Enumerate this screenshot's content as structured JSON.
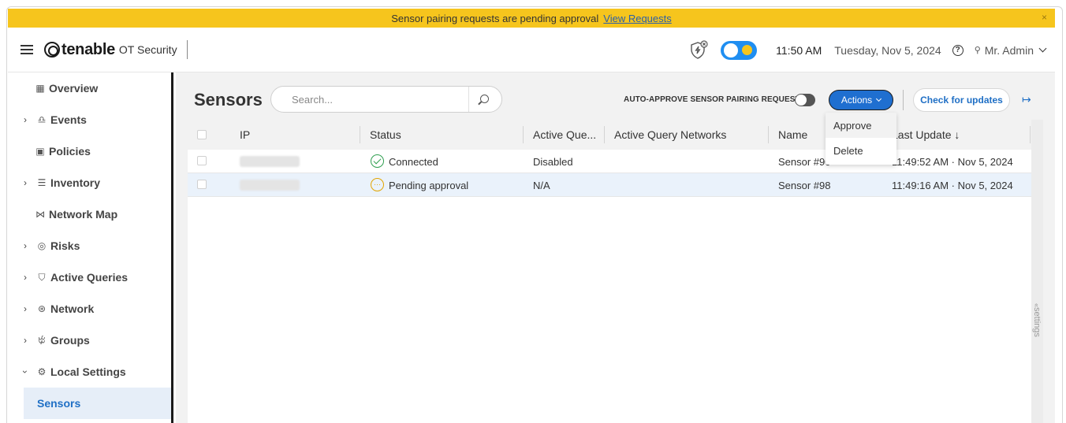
{
  "banner": {
    "message": "Sensor pairing requests are pending approval",
    "link": "View Requests",
    "close": "×"
  },
  "header": {
    "brand": "tenable",
    "product": "OT Security",
    "time": "11:50 AM",
    "date": "Tuesday, Nov 5, 2024",
    "help": "?",
    "user": "Mr. Admin",
    "theme_toggle": "dark-mode-toggle"
  },
  "sidebar": {
    "items": [
      {
        "label": "Overview",
        "icon": "grid-icon"
      },
      {
        "label": "Events",
        "icon": "bell-icon"
      },
      {
        "label": "Policies",
        "icon": "policies-icon"
      },
      {
        "label": "Inventory",
        "icon": "list-icon"
      },
      {
        "label": "Network Map",
        "icon": "network-map-icon"
      },
      {
        "label": "Risks",
        "icon": "risk-icon"
      },
      {
        "label": "Active Queries",
        "icon": "shield-icon"
      },
      {
        "label": "Network",
        "icon": "network-icon"
      },
      {
        "label": "Groups",
        "icon": "groups-icon"
      },
      {
        "label": "Local Settings",
        "icon": "settings-gear-icon"
      },
      {
        "label": "Sensors"
      }
    ]
  },
  "main": {
    "title": "Sensors",
    "search_placeholder": "Search...",
    "auto_approve_label": "AUTO-APPROVE SENSOR PAIRING REQUESTS",
    "actions_label": "Actions",
    "check_updates_label": "Check for updates",
    "settings_tab": "settings",
    "actions_menu": [
      "Approve",
      "Delete"
    ]
  },
  "table": {
    "columns": [
      "IP",
      "Status",
      "Active Que...",
      "Active Query Networks",
      "Name",
      "Last Update ↓"
    ],
    "rows": [
      {
        "status": "Connected",
        "status_type": "connected",
        "active_queries": "Disabled",
        "networks": "",
        "name": "Sensor #90",
        "last_update": "11:49:52 AM · Nov 5, 2024"
      },
      {
        "status": "Pending approval",
        "status_type": "pending",
        "active_queries": "N/A",
        "networks": "",
        "name": "Sensor #98",
        "last_update": "11:49:16 AM · Nov 5, 2024"
      }
    ]
  },
  "colors": {
    "banner": "#f6c51d",
    "accent": "#1f6fd0",
    "connected": "#2e9e4f",
    "pending": "#e2a400"
  }
}
